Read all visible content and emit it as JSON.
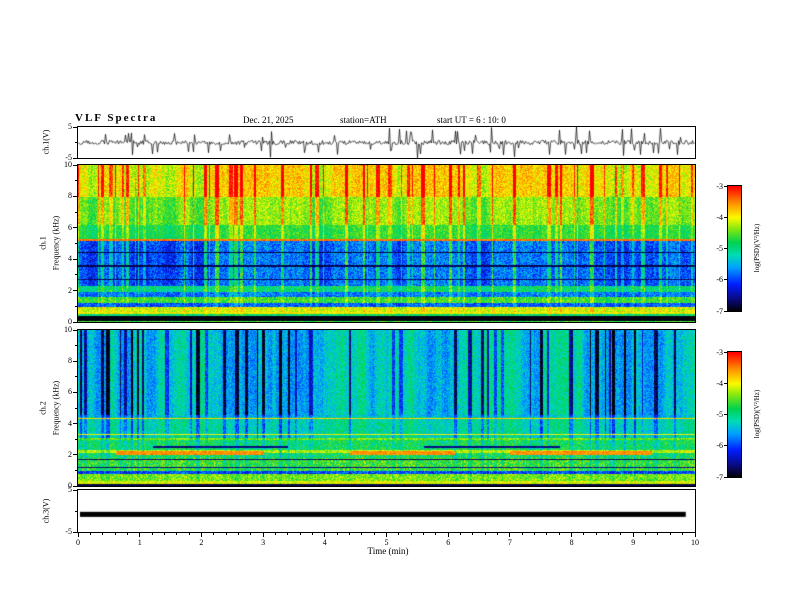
{
  "header": {
    "title": "VLF Spectra",
    "date": "Dec. 21, 2025",
    "station": "station=ATH",
    "start_ut": "start UT =  6 : 10: 0"
  },
  "x_axis": {
    "label": "Time (min)",
    "range": [
      0,
      10
    ],
    "ticks": [
      0,
      1,
      2,
      3,
      4,
      5,
      6,
      7,
      8,
      9,
      10
    ],
    "minor_step": 0.2
  },
  "panels": {
    "ch1_wave": {
      "ylabel": "ch.1(V)",
      "ylim": [
        -5,
        5
      ],
      "yticks": [
        5,
        -5
      ],
      "yminor": [
        0
      ]
    },
    "spec1": {
      "ylabel_line1": "ch.1",
      "ylabel_line2": "Frequency (kHz)",
      "f_range": [
        0,
        10
      ],
      "yticks": [
        0,
        2,
        4,
        6,
        8,
        10
      ],
      "yminor": [
        1,
        3,
        5,
        7,
        9
      ]
    },
    "spec2": {
      "ylabel_line1": "ch.2",
      "ylabel_line2": "Frequency (kHz)",
      "f_range": [
        0,
        10
      ],
      "yticks": [
        0,
        2,
        4,
        6,
        8,
        10
      ],
      "yminor": [
        1,
        3,
        5,
        7,
        9
      ]
    },
    "ch3": {
      "ylabel": "ch.3(V)",
      "ylim": [
        -5,
        5
      ],
      "yticks": [
        5,
        -5
      ],
      "yminor": [
        0
      ]
    }
  },
  "colorbar": {
    "label": "log(PSD)(V²/Hz)",
    "range": [
      -7,
      -3
    ],
    "ticks": [
      -3,
      -4,
      -5,
      -6,
      -7
    ],
    "stops": [
      {
        "t": 0.0,
        "rgb": [
          0,
          0,
          0
        ]
      },
      {
        "t": 0.1,
        "rgb": [
          10,
          10,
          130
        ]
      },
      {
        "t": 0.22,
        "rgb": [
          0,
          30,
          255
        ]
      },
      {
        "t": 0.35,
        "rgb": [
          0,
          160,
          255
        ]
      },
      {
        "t": 0.45,
        "rgb": [
          0,
          220,
          180
        ]
      },
      {
        "t": 0.55,
        "rgb": [
          0,
          210,
          80
        ]
      },
      {
        "t": 0.65,
        "rgb": [
          120,
          230,
          20
        ]
      },
      {
        "t": 0.75,
        "rgb": [
          250,
          250,
          0
        ]
      },
      {
        "t": 0.87,
        "rgb": [
          255,
          140,
          0
        ]
      },
      {
        "t": 1.0,
        "rgb": [
          255,
          0,
          0
        ]
      }
    ]
  },
  "chart_data": [
    {
      "type": "line",
      "panel": "ch1-waveform",
      "title": "ch.1 broadband voltage vs time",
      "x_range_min": [
        0,
        10
      ],
      "ylim": [
        -5,
        5
      ],
      "signal": {
        "baseline": 0,
        "noise_amp": 0.7,
        "spike_prob": 0.12,
        "spike_amp": 4.5
      }
    },
    {
      "type": "heatmap",
      "panel": "ch1-spectrogram",
      "title": "ch.1 VLF spectrogram",
      "x_range_min": [
        0,
        10
      ],
      "f_range_khz": [
        0,
        10
      ],
      "value_range_logpsd": [
        -7,
        -3
      ],
      "bands": [
        {
          "f0": 8.0,
          "f1": 10.0,
          "base": -4.3,
          "noise": 0.35,
          "streak": 1.15
        },
        {
          "f0": 6.2,
          "f1": 8.0,
          "base": -4.65,
          "noise": 0.3,
          "streak": 0.85
        },
        {
          "f0": 5.35,
          "f1": 6.2,
          "base": -4.9,
          "noise": 0.3,
          "streak": 0.6
        },
        {
          "f0": 2.3,
          "f1": 5.35,
          "base": -6.15,
          "noise": 0.4,
          "streak": 0.95
        },
        {
          "f0": 1.95,
          "f1": 2.3,
          "base": -5.1,
          "noise": 0.35,
          "streak": 0.5
        },
        {
          "f0": 1.6,
          "f1": 1.95,
          "base": -5.9,
          "noise": 0.4,
          "streak": 0.4
        },
        {
          "f0": 1.25,
          "f1": 1.6,
          "base": -4.7,
          "noise": 0.35,
          "streak": 0.3
        },
        {
          "f0": 1.0,
          "f1": 1.25,
          "base": -6.0,
          "noise": 0.4,
          "streak": 0.3
        },
        {
          "f0": 0.55,
          "f1": 1.0,
          "base": -4.2,
          "noise": 0.35,
          "streak": 0.25
        },
        {
          "f0": 0.4,
          "f1": 0.55,
          "base": -5.0,
          "noise": 0.35,
          "streak": 0.2
        },
        {
          "f0": 0.12,
          "f1": 0.4,
          "base": -6.95,
          "noise": 0.08,
          "streak": 0.0
        },
        {
          "f0": 0.0,
          "f1": 0.12,
          "base": -4.6,
          "noise": 0.3,
          "streak": 0.0
        }
      ],
      "hlines": [
        {
          "f": 5.25,
          "wd": 0.06,
          "value": -3.45
        },
        {
          "f": 4.45,
          "wd": 0.05,
          "value": -6.8
        },
        {
          "f": 3.6,
          "wd": 0.05,
          "value": -6.75
        },
        {
          "f": 2.75,
          "wd": 0.05,
          "value": -6.7
        },
        {
          "f": 0.62,
          "wd": 0.03,
          "value": -3.9
        }
      ],
      "segments": []
    },
    {
      "type": "heatmap",
      "panel": "ch2-spectrogram",
      "title": "ch.2 VLF spectrogram",
      "x_range_min": [
        0,
        10
      ],
      "f_range_khz": [
        0,
        10
      ],
      "value_range_logpsd": [
        -7,
        -3
      ],
      "bands": [
        {
          "f0": 4.6,
          "f1": 10.0,
          "base": -5.0,
          "noise": 0.32,
          "streak": -1.35
        },
        {
          "f0": 4.45,
          "f1": 4.6,
          "base": -5.3,
          "noise": 0.3,
          "streak": -0.6
        },
        {
          "f0": 3.1,
          "f1": 4.45,
          "base": -4.95,
          "noise": 0.35,
          "streak": -0.7
        },
        {
          "f0": 2.95,
          "f1": 3.1,
          "base": -4.35,
          "noise": 0.3,
          "streak": -0.3
        },
        {
          "f0": 2.35,
          "f1": 2.95,
          "base": -4.75,
          "noise": 0.4,
          "streak": -0.4
        },
        {
          "f0": 2.15,
          "f1": 2.35,
          "base": -4.15,
          "noise": 0.35,
          "streak": -0.2
        },
        {
          "f0": 1.85,
          "f1": 2.15,
          "base": -4.8,
          "noise": 0.45,
          "streak": -0.3
        },
        {
          "f0": 1.0,
          "f1": 1.85,
          "base": -4.55,
          "noise": 0.45,
          "streak": -0.3
        },
        {
          "f0": 0.82,
          "f1": 1.0,
          "base": -5.9,
          "noise": 0.4,
          "streak": -0.2
        },
        {
          "f0": 0.35,
          "f1": 0.82,
          "base": -4.35,
          "noise": 0.35,
          "streak": -0.15
        },
        {
          "f0": 0.15,
          "f1": 0.35,
          "base": -4.05,
          "noise": 0.3,
          "streak": -0.1
        },
        {
          "f0": 0.0,
          "f1": 0.15,
          "base": -6.8,
          "noise": 0.15,
          "streak": 0.0
        }
      ],
      "hlines": [
        {
          "f": 4.35,
          "wd": 0.05,
          "value": -3.8
        },
        {
          "f": 3.35,
          "wd": 0.03,
          "value": -4.0
        },
        {
          "f": 1.72,
          "wd": 0.04,
          "value": -6.7
        },
        {
          "f": 1.2,
          "wd": 0.04,
          "value": -6.6
        }
      ],
      "segments": [
        {
          "f0": 2.0,
          "f1": 2.25,
          "x0": 0.06,
          "x1": 0.3,
          "value": -3.55
        },
        {
          "f0": 2.0,
          "f1": 2.25,
          "x0": 0.44,
          "x1": 0.61,
          "value": -3.55
        },
        {
          "f0": 2.0,
          "f1": 2.25,
          "x0": 0.7,
          "x1": 0.93,
          "value": -3.55
        },
        {
          "f0": 2.48,
          "f1": 2.62,
          "x0": 0.12,
          "x1": 0.34,
          "value": -6.6
        },
        {
          "f0": 2.48,
          "f1": 2.62,
          "x0": 0.56,
          "x1": 0.78,
          "value": -6.6
        }
      ]
    },
    {
      "type": "line",
      "panel": "ch3-waveform",
      "title": "ch.3 voltage vs time (flat / off)",
      "x_range_min": [
        0,
        10
      ],
      "ylim": [
        -5,
        5
      ],
      "signal": {
        "flat": true,
        "level": -0.8,
        "thickness_v": 1.2,
        "x_end": 0.985
      }
    }
  ]
}
